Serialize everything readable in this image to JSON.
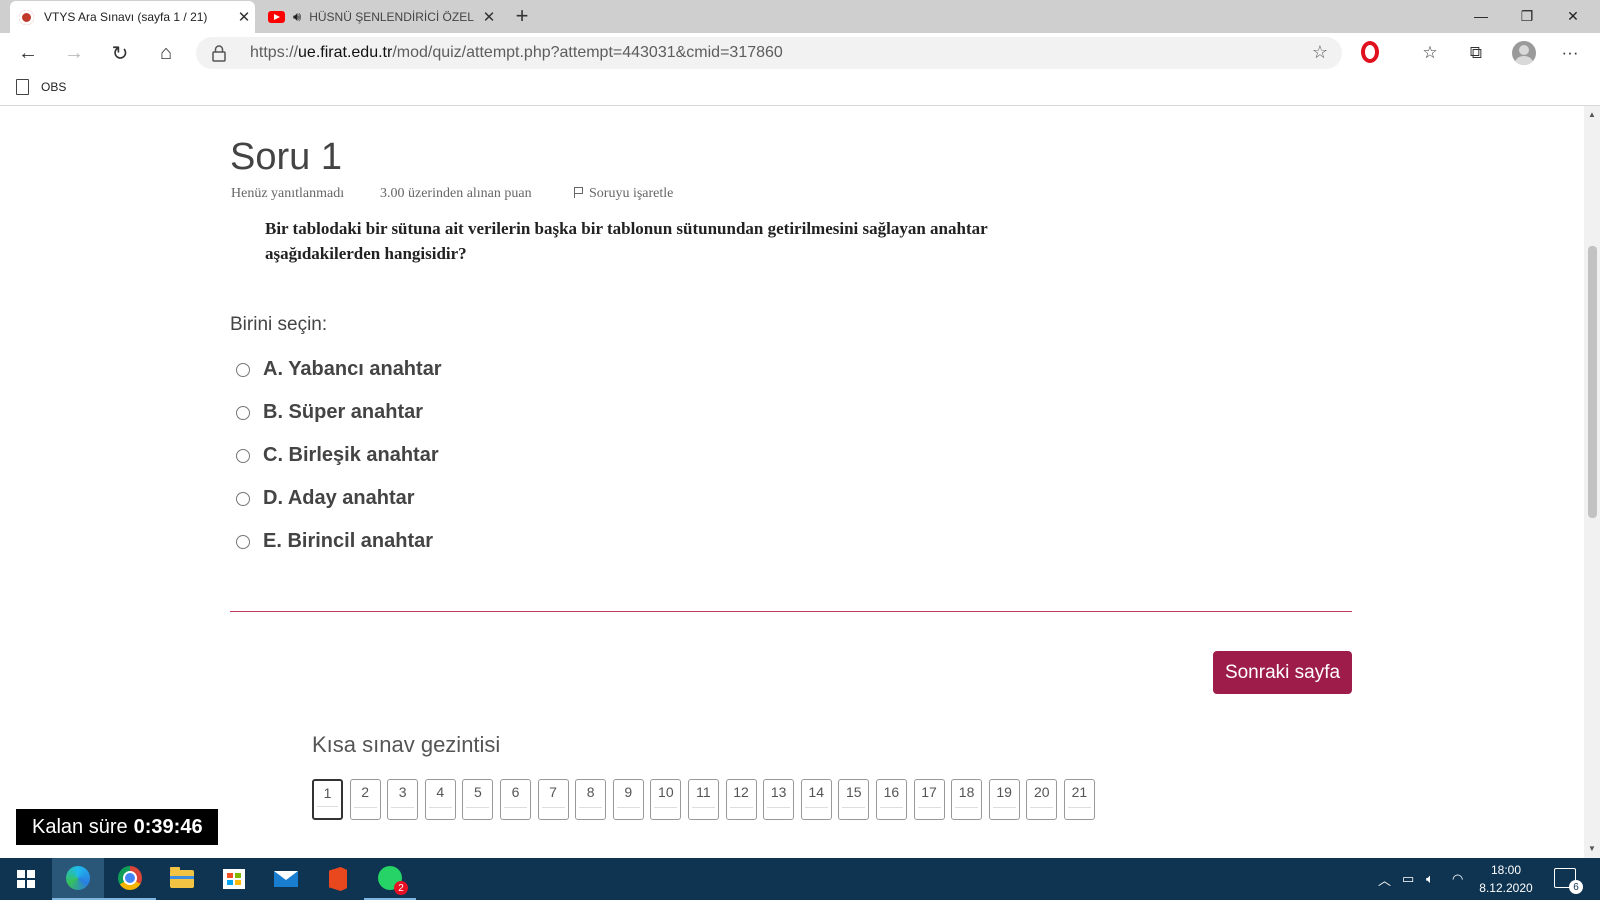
{
  "browser": {
    "tabs": [
      {
        "title": "VTYS Ara Sınavı (sayfa 1 / 21)",
        "active": true
      },
      {
        "title": "HÜSNÜ ŞENLENDİRİCİ ÖZEL",
        "active": false,
        "audio": true
      }
    ],
    "url_prefix": "https://",
    "url_host": "ue.firat.edu.tr",
    "url_path": "/mod/quiz/attempt.php?attempt=443031&cmid=317860",
    "bookmarks": [
      {
        "label": "OBS"
      }
    ]
  },
  "question": {
    "title": "Soru 1",
    "status": "Henüz yanıtlanmadı",
    "points": "3.00 üzerinden alınan puan",
    "flag_label": "Soruyu işaretle",
    "text": "Bir tablodaki bir sütuna ait verilerin başka bir tablonun sütunundan getirilmesini sağlayan anahtar aşağıdakilerden hangisidir?",
    "prompt": "Birini seçin:",
    "options": [
      {
        "label": "A. Yabancı anahtar",
        "selected": false
      },
      {
        "label": "B. Süper anahtar",
        "selected": false
      },
      {
        "label": "C. Birleşik anahtar",
        "selected": false
      },
      {
        "label": "D. Aday anahtar",
        "selected": false
      },
      {
        "label": "E. Birincil anahtar",
        "selected": false
      }
    ]
  },
  "next_button": "Sonraki sayfa",
  "quiz_nav": {
    "title": "Kısa sınav gezintisi",
    "current": "1",
    "items": [
      "1",
      "2",
      "3",
      "4",
      "5",
      "6",
      "7",
      "8",
      "9",
      "10",
      "11",
      "12",
      "13",
      "14",
      "15",
      "16",
      "17",
      "18",
      "19",
      "20",
      "21"
    ]
  },
  "timer": {
    "label": "Kalan süre",
    "value": "0:39:46"
  },
  "taskbar": {
    "time": "18:00",
    "date": "8.12.2020",
    "whatsapp_badge": "2",
    "notification_count": "6"
  },
  "colors": {
    "accent": "#9e1c4a",
    "taskbar": "#0f3451"
  }
}
